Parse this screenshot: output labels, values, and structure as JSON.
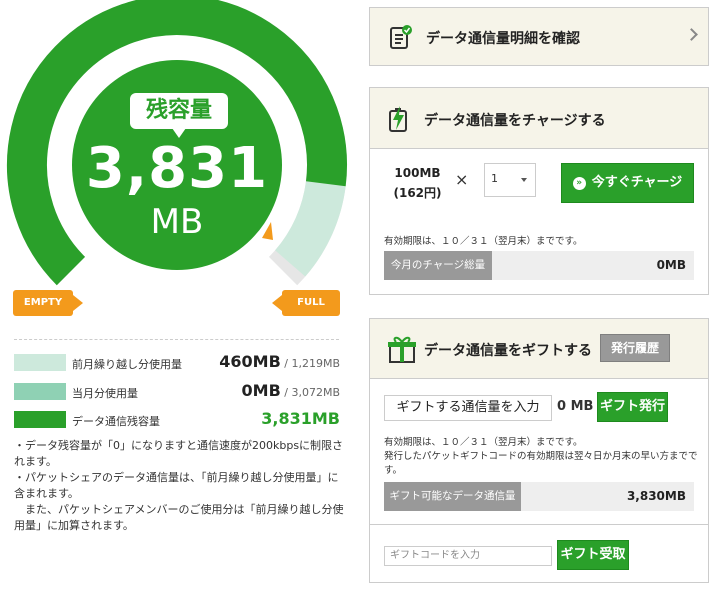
{
  "gauge": {
    "bubble_label": "残容量",
    "value": "3,831",
    "unit": "MB",
    "empty_label": "EMPTY",
    "full_label": "FULL",
    "remaining_fraction": 0.86,
    "colors": {
      "main": "#2aa02a",
      "carryover": "#cde9dc",
      "track": "#e6e6e6",
      "accent": "#f39a1c"
    }
  },
  "legend": [
    {
      "label": "前月繰り越し分使用量",
      "value": "460MB",
      "total": "/ 1,219MB",
      "color": "#cde9dc"
    },
    {
      "label": "当月分使用量",
      "value": "0MB",
      "total": "/ 3,072MB",
      "color": "#8fd1b4"
    },
    {
      "label": "データ通信残容量",
      "value": "3,831MB",
      "total": "",
      "color": "#2aa02a"
    }
  ],
  "notes": [
    "・データ残容量が「0」になりますと通信速度が200kbpsに制限されます。",
    "・パケットシェアのデータ通信量は、「前月繰り越し分使用量」に含まれます。",
    "　また、パケットシェアメンバーのご使用分は「前月繰り越し分使用量」に加算されます。"
  ],
  "detail_panel": {
    "title": "データ通信量明細を確認",
    "icon": "clipboard-check-icon"
  },
  "charge_panel": {
    "title": "データ通信量をチャージする",
    "icon": "battery-charge-icon",
    "price_amount": "100MB",
    "price_yen": "(162円)",
    "times": "×",
    "quantity": "1",
    "button_label": "今すぐチャージ",
    "validity_note": "有効期限は、１０／３１（翌月末）までです。",
    "total_label": "今月のチャージ総量",
    "total_value": "0MB"
  },
  "gift_panel": {
    "title": "データ通信量をギフトする",
    "icon": "gift-box-icon",
    "history_button": "発行履歴",
    "input_placeholder": "ギフトする通信量を入力",
    "input_unit": "0 MB",
    "issue_button": "ギフト発行",
    "validity_note": "有効期限は、１０／３１（翌月末）までです。",
    "code_validity_note": "発行したパケットギフトコードの有効期限は翌々日か月末の早い方までです。",
    "available_label": "ギフト可能なデータ通信量",
    "available_value": "3,830MB",
    "code_placeholder": "ギフトコードを入力",
    "receive_button": "ギフト受取"
  }
}
